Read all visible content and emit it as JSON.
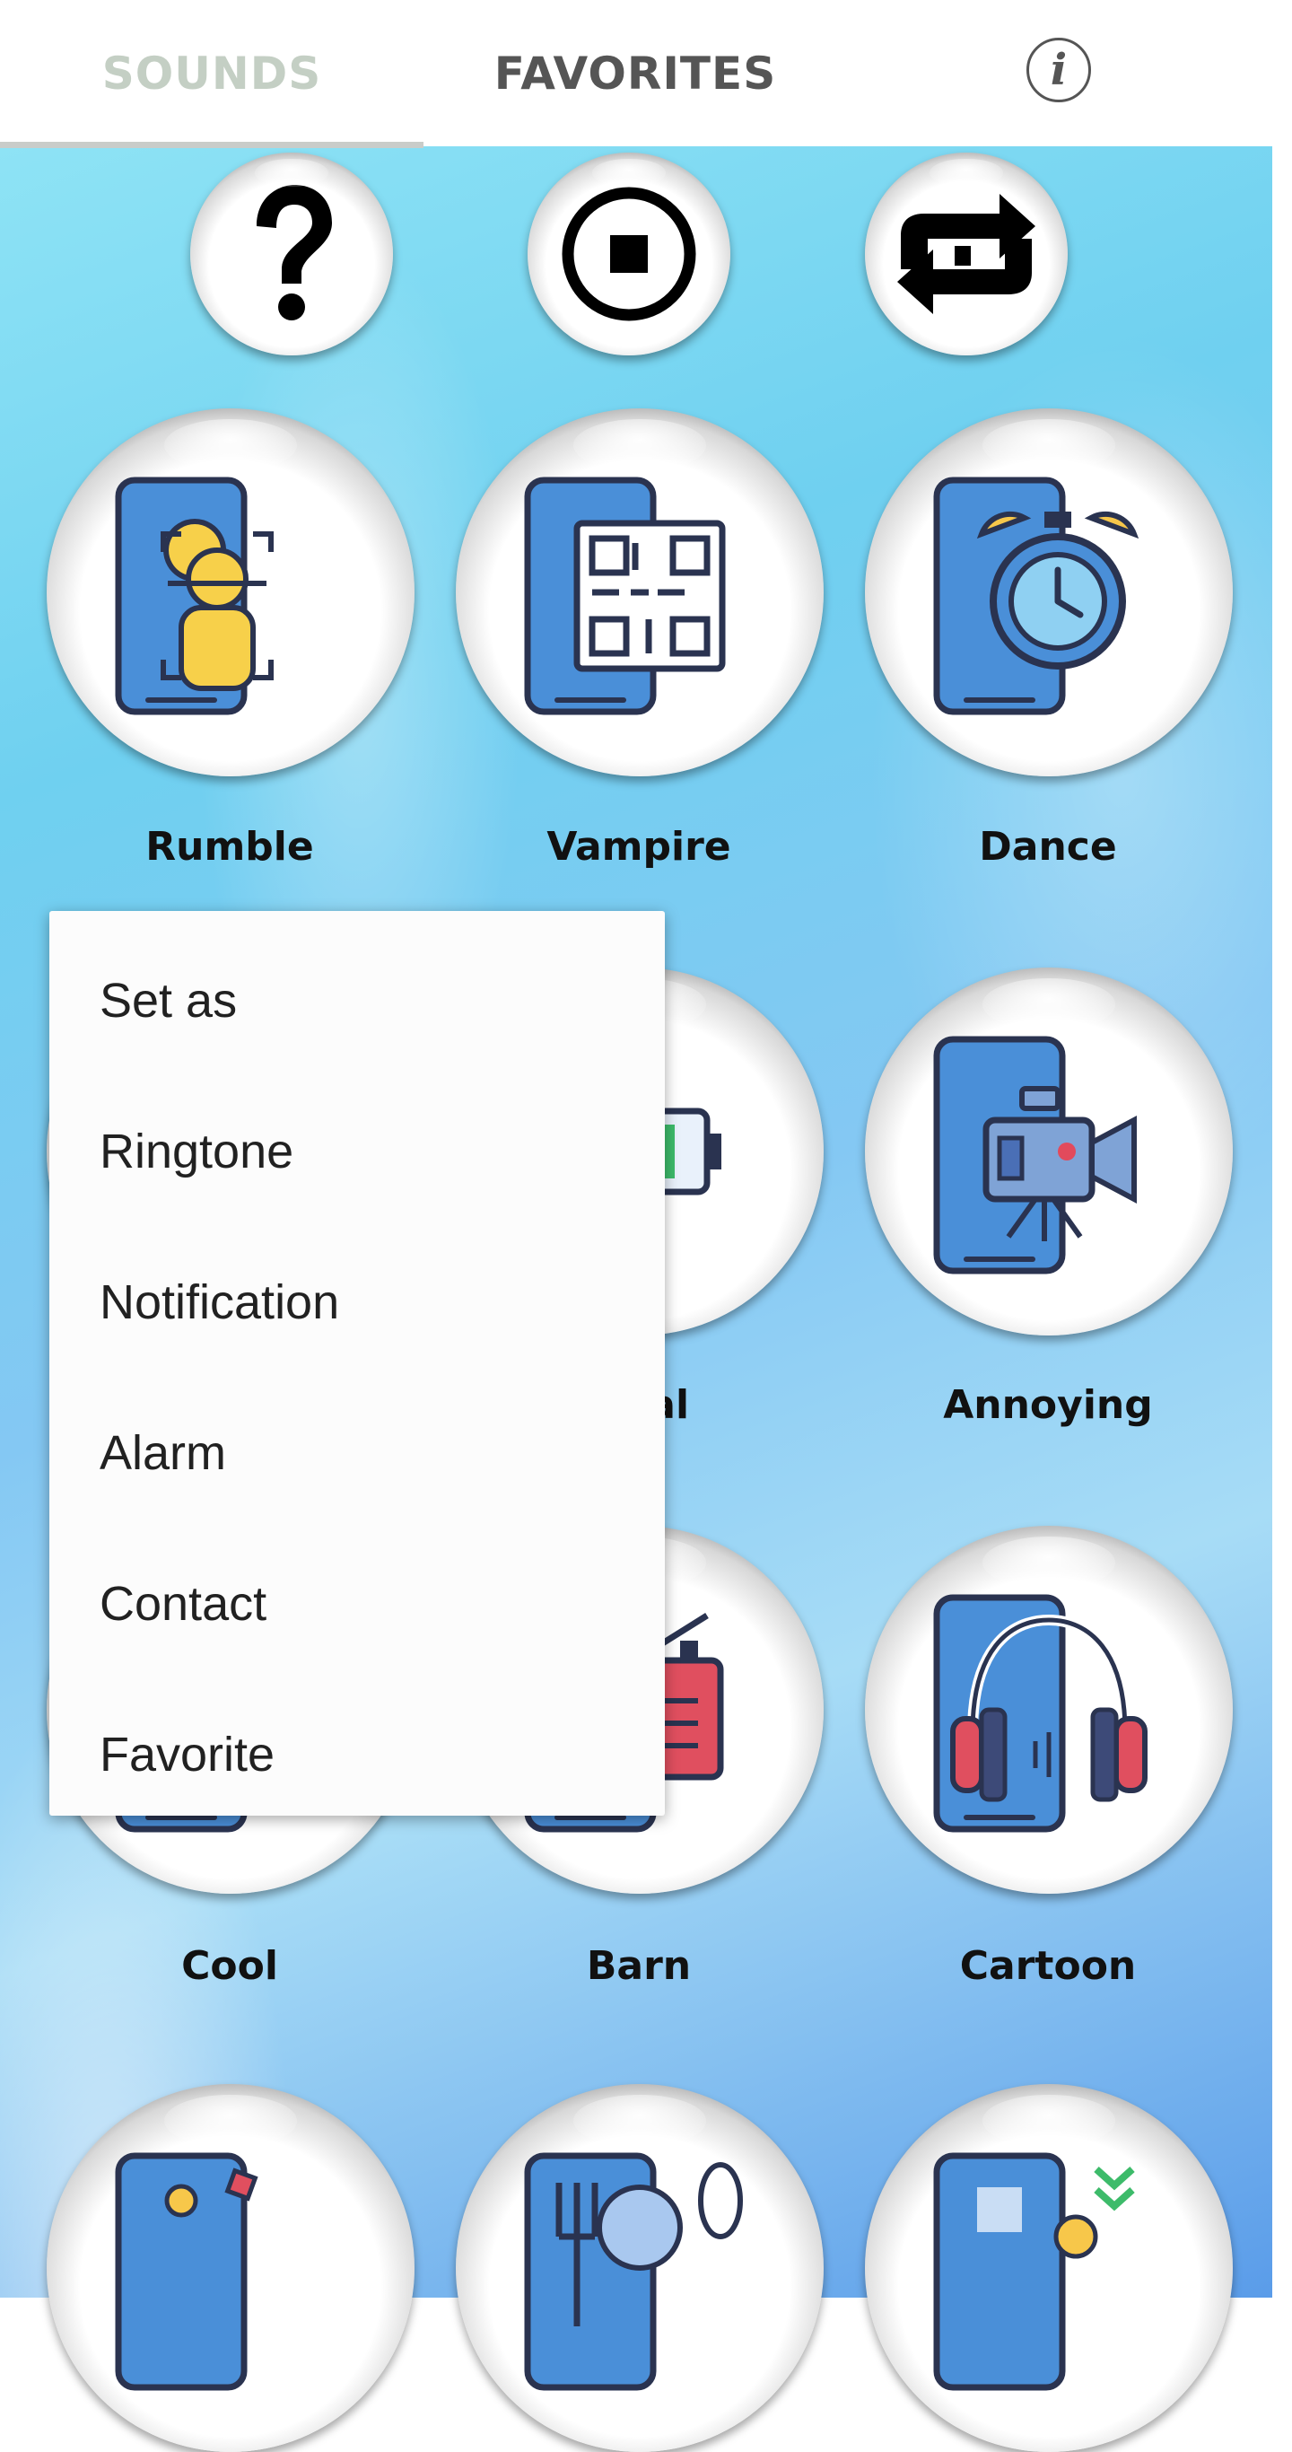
{
  "tabs": [
    {
      "label": "SOUNDS",
      "selected": true
    },
    {
      "label": "FAVORITES",
      "selected": false
    }
  ],
  "info_icon": "info-icon",
  "controls": [
    {
      "name": "help",
      "icon": "question-mark-icon"
    },
    {
      "name": "stop",
      "icon": "stop-icon"
    },
    {
      "name": "repeat",
      "icon": "repeat-icon"
    }
  ],
  "sounds": [
    {
      "label": "Rumble",
      "icon": "phone-face-scan-icon"
    },
    {
      "label": "Vampire",
      "icon": "phone-qr-code-icon"
    },
    {
      "label": "Dance",
      "icon": "phone-alarm-clock-icon"
    },
    {
      "label": "Musical",
      "icon": "phone-battery-icon"
    },
    {
      "label": "Annoying",
      "icon": "phone-video-camera-icon"
    },
    {
      "label": "Cool",
      "icon": "phone-icon"
    },
    {
      "label": "Barn",
      "icon": "phone-radio-icon"
    },
    {
      "label": "Cartoon",
      "icon": "phone-headphones-icon"
    },
    {
      "label": "",
      "icon": "phone-game-icon"
    },
    {
      "label": "",
      "icon": "phone-food-icon"
    },
    {
      "label": "",
      "icon": "phone-payment-icon"
    }
  ],
  "sounds_visible_labels": {
    "musical_partial": "sical"
  },
  "context_menu": {
    "title": "Set as",
    "items": [
      "Ringtone",
      "Notification",
      "Alarm",
      "Contact",
      "Favorite"
    ]
  },
  "colors": {
    "tab_active_text": "#c4cfc4",
    "tab_inactive_text": "#555555",
    "phone_blue": "#4a8fd8",
    "outline": "#2a3350"
  }
}
